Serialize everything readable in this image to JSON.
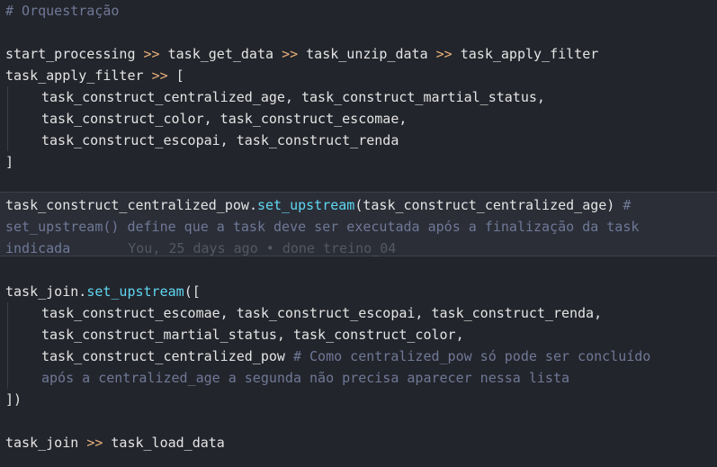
{
  "code": {
    "header_comment": "# Orquestração",
    "l1": {
      "a": "start_processing",
      "op1": ">>",
      "b": "task_get_data",
      "op2": ">>",
      "c": "task_unzip_data",
      "op3": ">>",
      "d": "task_apply_filter"
    },
    "l2": {
      "a": "task_apply_filter",
      "op": ">>",
      "bracket": "["
    },
    "l3": "task_construct_centralized_age, task_construct_martial_status,",
    "l4": "task_construct_color, task_construct_escomae,",
    "l5": "task_construct_escopai, task_construct_renda",
    "l6": "]",
    "l7": {
      "obj": "task_construct_centralized_pow",
      "dot": ".",
      "method": "set_upstream",
      "args": "(task_construct_centralized_age)",
      "comment_start": " #"
    },
    "l8_comment": "set_upstream() define que a task deve ser executada após a finalização da task",
    "l9_comment": "indicada",
    "blame": "You, 25 days ago • done treino_04",
    "l10": {
      "obj": "task_join",
      "dot": ".",
      "method": "set_upstream",
      "rest": "(["
    },
    "l11": "task_construct_escomae, task_construct_escopai, task_construct_renda,",
    "l12": "task_construct_martial_status, task_construct_color,",
    "l13": {
      "code": "task_construct_centralized_pow",
      "comment": " # Como centralized_pow só pode ser concluído"
    },
    "l14_comment": "após a centralized_age a segunda não precisa aparecer nessa lista",
    "l15": "])",
    "l16": {
      "a": "task_join",
      "op": ">>",
      "b": "task_load_data"
    }
  },
  "colors": {
    "background": "#23252c",
    "text": "#e4e4e4",
    "comment": "#6f7997",
    "operator": "#e8b07a",
    "method": "#5fd7f2",
    "blame": "#545862"
  }
}
